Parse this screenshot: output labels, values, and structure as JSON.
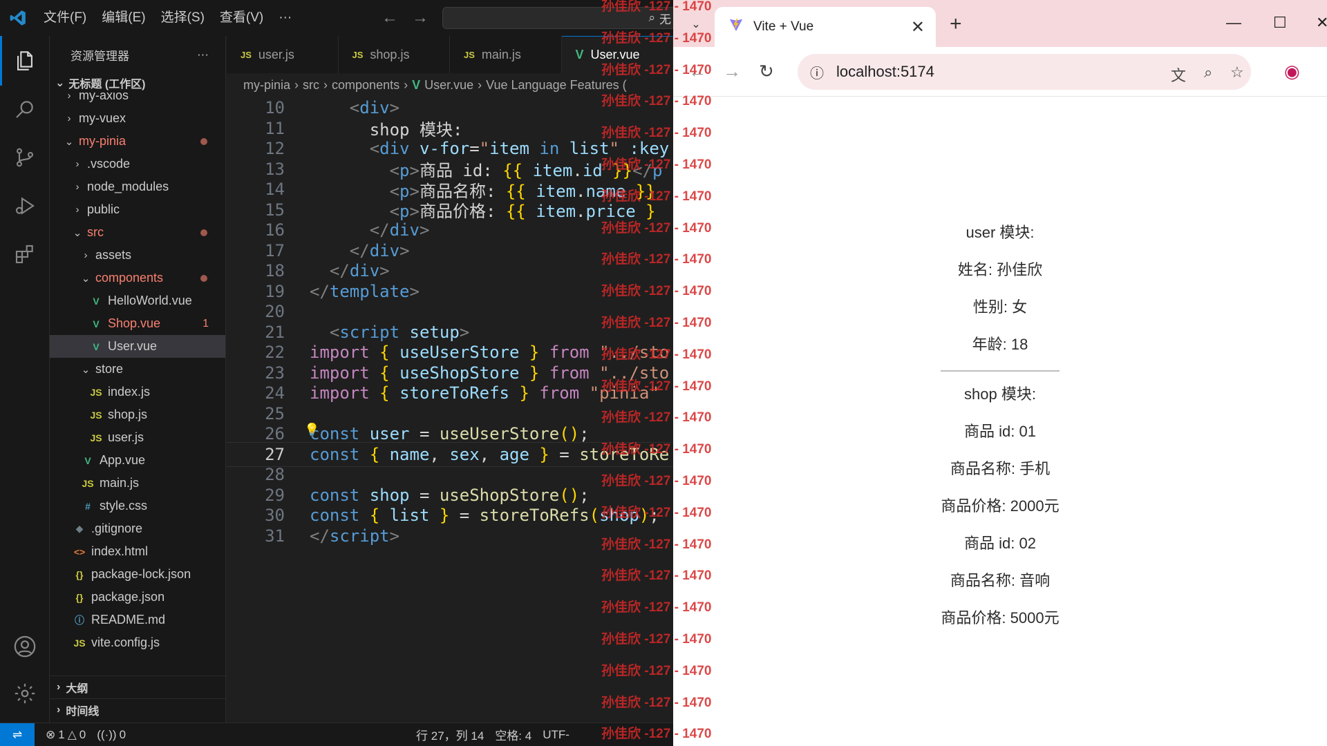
{
  "vscode": {
    "menu": [
      "文件(F)",
      "编辑(E)",
      "选择(S)",
      "查看(V)",
      "···"
    ],
    "command_center_text": "无",
    "explorer_title": "资源管理器",
    "explorer_more": "···",
    "workspace_title": "无标题 (工作区)",
    "tree": [
      {
        "label": "my-axios",
        "chev": "›",
        "icon": "",
        "style": "normal"
      },
      {
        "label": "my-vuex",
        "chev": "›",
        "icon": "",
        "style": "normal"
      },
      {
        "label": "my-pinia",
        "chev": "⌄",
        "icon": "",
        "style": "err"
      },
      {
        "label": ".vscode",
        "chev": "›",
        "icon": "",
        "style": "normal"
      },
      {
        "label": "node_modules",
        "chev": "›",
        "icon": "",
        "style": "normal"
      },
      {
        "label": "public",
        "chev": "›",
        "icon": "",
        "style": "normal"
      },
      {
        "label": "src",
        "chev": "⌄",
        "icon": "",
        "style": "err"
      },
      {
        "label": "assets",
        "chev": "›",
        "icon": "",
        "style": "normal"
      },
      {
        "label": "components",
        "chev": "⌄",
        "icon": "",
        "style": "err"
      },
      {
        "label": "HelloWorld.vue",
        "chev": "",
        "icon": "V",
        "style": "normal"
      },
      {
        "label": "Shop.vue",
        "chev": "",
        "icon": "V",
        "style": "err",
        "badge": "1"
      },
      {
        "label": "User.vue",
        "chev": "",
        "icon": "V",
        "style": "normal"
      },
      {
        "label": "store",
        "chev": "⌄",
        "icon": "",
        "style": "normal"
      },
      {
        "label": "index.js",
        "chev": "",
        "icon": "JS",
        "style": "normal"
      },
      {
        "label": "shop.js",
        "chev": "",
        "icon": "JS",
        "style": "normal"
      },
      {
        "label": "user.js",
        "chev": "",
        "icon": "JS",
        "style": "normal"
      },
      {
        "label": "App.vue",
        "chev": "",
        "icon": "V",
        "style": "normal"
      },
      {
        "label": "main.js",
        "chev": "",
        "icon": "JS",
        "style": "normal"
      },
      {
        "label": "style.css",
        "chev": "",
        "icon": "#",
        "style": "normal"
      },
      {
        "label": ".gitignore",
        "chev": "",
        "icon": "◆",
        "style": "normal"
      },
      {
        "label": "index.html",
        "chev": "",
        "icon": "<>",
        "style": "normal"
      },
      {
        "label": "package-lock.json",
        "chev": "",
        "icon": "{}",
        "style": "normal"
      },
      {
        "label": "package.json",
        "chev": "",
        "icon": "{}",
        "style": "normal"
      },
      {
        "label": "README.md",
        "chev": "",
        "icon": "ⓘ",
        "style": "normal"
      },
      {
        "label": "vite.config.js",
        "chev": "",
        "icon": "JS",
        "style": "normal"
      }
    ],
    "outline_label": "大纲",
    "timeline_label": "时间线",
    "tabs": [
      {
        "label": "user.js",
        "type": "JS"
      },
      {
        "label": "shop.js",
        "type": "JS"
      },
      {
        "label": "main.js",
        "type": "JS"
      },
      {
        "label": "User.vue",
        "type": "V"
      }
    ],
    "breadcrumb": [
      "my-pinia",
      "src",
      "components",
      "User.vue",
      "Vue Language Features ("
    ],
    "code_lines": [
      {
        "n": "10",
        "html": "    <span class='punc'>&lt;</span><span class='tag'>div</span><span class='punc'>&gt;</span>"
      },
      {
        "n": "11",
        "html": "      shop 模块:"
      },
      {
        "n": "12",
        "html": "      <span class='punc'>&lt;</span><span class='tag'>div</span> <span class='attr'>v-for</span>=<span class='str'>\"</span><span class='var'>item</span> <span class='kw'>in</span> <span class='var'>list</span><span class='str'>\"</span> <span class='attr'>:key</span>"
      },
      {
        "n": "13",
        "html": "        <span class='punc'>&lt;</span><span class='tag'>p</span><span class='punc'>&gt;</span>商品 id: <span class='br1'>{{</span> <span class='var'>item</span>.<span class='var'>id</span> <span class='br1'>}}</span><span class='punc'>&lt;/</span><span class='tag'>p</span>"
      },
      {
        "n": "14",
        "html": "        <span class='punc'>&lt;</span><span class='tag'>p</span><span class='punc'>&gt;</span>商品名称: <span class='br1'>{{</span> <span class='var'>item</span>.<span class='var'>name</span> <span class='br1'>}}</span>"
      },
      {
        "n": "15",
        "html": "        <span class='punc'>&lt;</span><span class='tag'>p</span><span class='punc'>&gt;</span>商品价格: <span class='br1'>{{</span> <span class='var'>item</span>.<span class='var'>price</span> <span class='br1'>}</span>"
      },
      {
        "n": "16",
        "html": "      <span class='punc'>&lt;/</span><span class='tag'>div</span><span class='punc'>&gt;</span>"
      },
      {
        "n": "17",
        "html": "    <span class='punc'>&lt;/</span><span class='tag'>div</span><span class='punc'>&gt;</span>"
      },
      {
        "n": "18",
        "html": "  <span class='punc'>&lt;/</span><span class='tag'>div</span><span class='punc'>&gt;</span>"
      },
      {
        "n": "19",
        "html": "<span class='punc'>&lt;/</span><span class='tag'>template</span><span class='punc'>&gt;</span>"
      },
      {
        "n": "20",
        "html": ""
      },
      {
        "n": "21",
        "html": "  <span class='punc'>&lt;</span><span class='tag'>script</span> <span class='attr'>setup</span><span class='punc'>&gt;</span>"
      },
      {
        "n": "22",
        "html": "<span class='ctl'>import</span> <span class='br1'>{</span> <span class='var'>useUserStore</span> <span class='br1'>}</span> <span class='ctl'>from</span> <span class='str'>\"../sto</span>"
      },
      {
        "n": "23",
        "html": "<span class='ctl'>import</span> <span class='br1'>{</span> <span class='var'>useShopStore</span> <span class='br1'>}</span> <span class='ctl'>from</span> <span class='str'>\"../sto</span>"
      },
      {
        "n": "24",
        "html": "<span class='ctl'>import</span> <span class='br1'>{</span> <span class='var'>storeToRefs</span> <span class='br1'>}</span> <span class='ctl'>from</span> <span class='str'>\"pinia\"</span>"
      },
      {
        "n": "25",
        "html": ""
      },
      {
        "n": "26",
        "html": "<span class='kw'>const</span> <span class='var'>user</span> = <span class='fn'>useUserStore</span><span class='br1'>()</span>;"
      },
      {
        "n": "27",
        "html": "<span class='kw'>const</span> <span class='br1'>{</span> <span class='var'>name</span>, <span class='var'>sex</span>, <span class='var'>age</span> <span class='br1'>}</span> = <span class='fn'>storeToRe</span>"
      },
      {
        "n": "28",
        "html": ""
      },
      {
        "n": "29",
        "html": "<span class='kw'>const</span> <span class='var'>shop</span> = <span class='fn'>useShopStore</span><span class='br1'>()</span>;"
      },
      {
        "n": "30",
        "html": "<span class='kw'>const</span> <span class='br1'>{</span> <span class='var'>list</span> <span class='br1'>}</span> = <span class='fn'>storeToRefs</span><span class='br1'>(</span><span class='var'>shop</span><span class='br1'>)</span>;"
      },
      {
        "n": "31",
        "html": "<span class='punc'>&lt;/</span><span class='tag'>script</span><span class='punc'>&gt;</span>"
      }
    ],
    "current_line": "27",
    "status": {
      "errors": "1",
      "warnings": "0",
      "ports": "0",
      "cursor": "行 27，列 14",
      "indent": "空格: 4",
      "encoding": "UTF-"
    }
  },
  "browser": {
    "tab_title": "Vite + Vue",
    "tab_close": "✕",
    "new_tab": "+",
    "url": "localhost:5174",
    "page": {
      "user_heading": "user 模块:",
      "name_line": "姓名: 孙佳欣",
      "sex_line": "性别: 女",
      "age_line": "年龄: 18",
      "shop_heading": "shop 模块:",
      "items": [
        {
          "id": "商品 id: 01",
          "name": "商品名称: 手机",
          "price": "商品价格: 2000元"
        },
        {
          "id": "商品 id: 02",
          "name": "商品名称: 音响",
          "price": "商品价格: 5000元"
        }
      ]
    }
  },
  "watermark": {
    "text": "孙佳欣 -127 - 1470",
    "count": 24
  }
}
